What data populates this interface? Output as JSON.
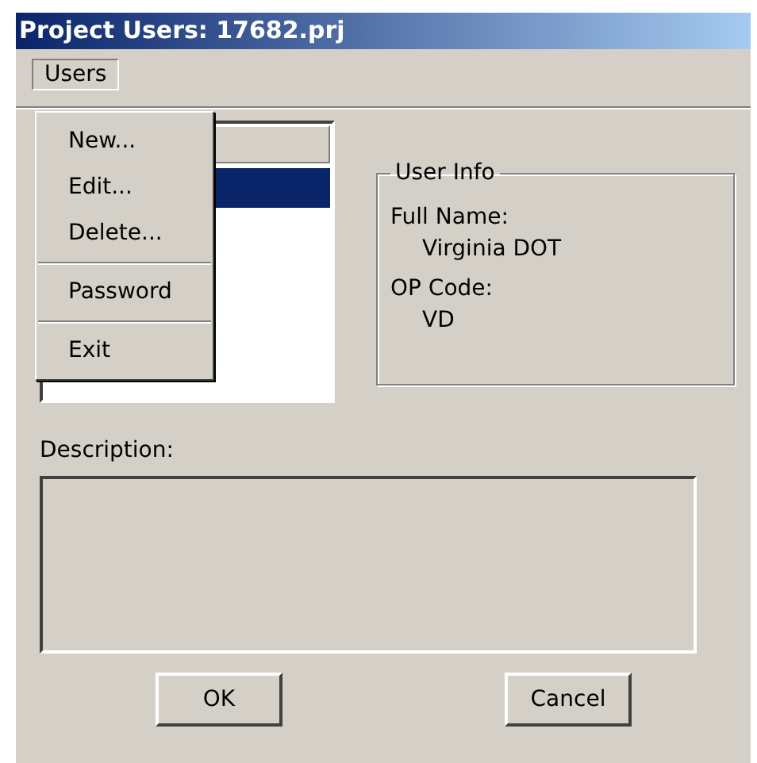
{
  "window": {
    "title": "Project Users: 17682.prj"
  },
  "menu_bar": [
    {
      "label": "Users",
      "open": true
    }
  ],
  "menu": [
    {
      "kind": "item",
      "label": "New..."
    },
    {
      "kind": "item",
      "label": "Edit..."
    },
    {
      "kind": "item",
      "label": "Delete..."
    },
    {
      "kind": "separator"
    },
    {
      "kind": "item",
      "label": "Password"
    },
    {
      "kind": "separator"
    },
    {
      "kind": "item",
      "label": "Exit"
    }
  ],
  "user_list": {
    "rows": [
      {
        "selected": true
      }
    ]
  },
  "user_info": {
    "title": "User Info",
    "fields": [
      {
        "label": "Full Name:",
        "value": "Virginia DOT"
      },
      {
        "label": "OP Code:",
        "value": "VD"
      }
    ]
  },
  "description": {
    "label": "Description:"
  },
  "buttons": [
    {
      "label": "OK"
    },
    {
      "label": "Cancel"
    }
  ]
}
